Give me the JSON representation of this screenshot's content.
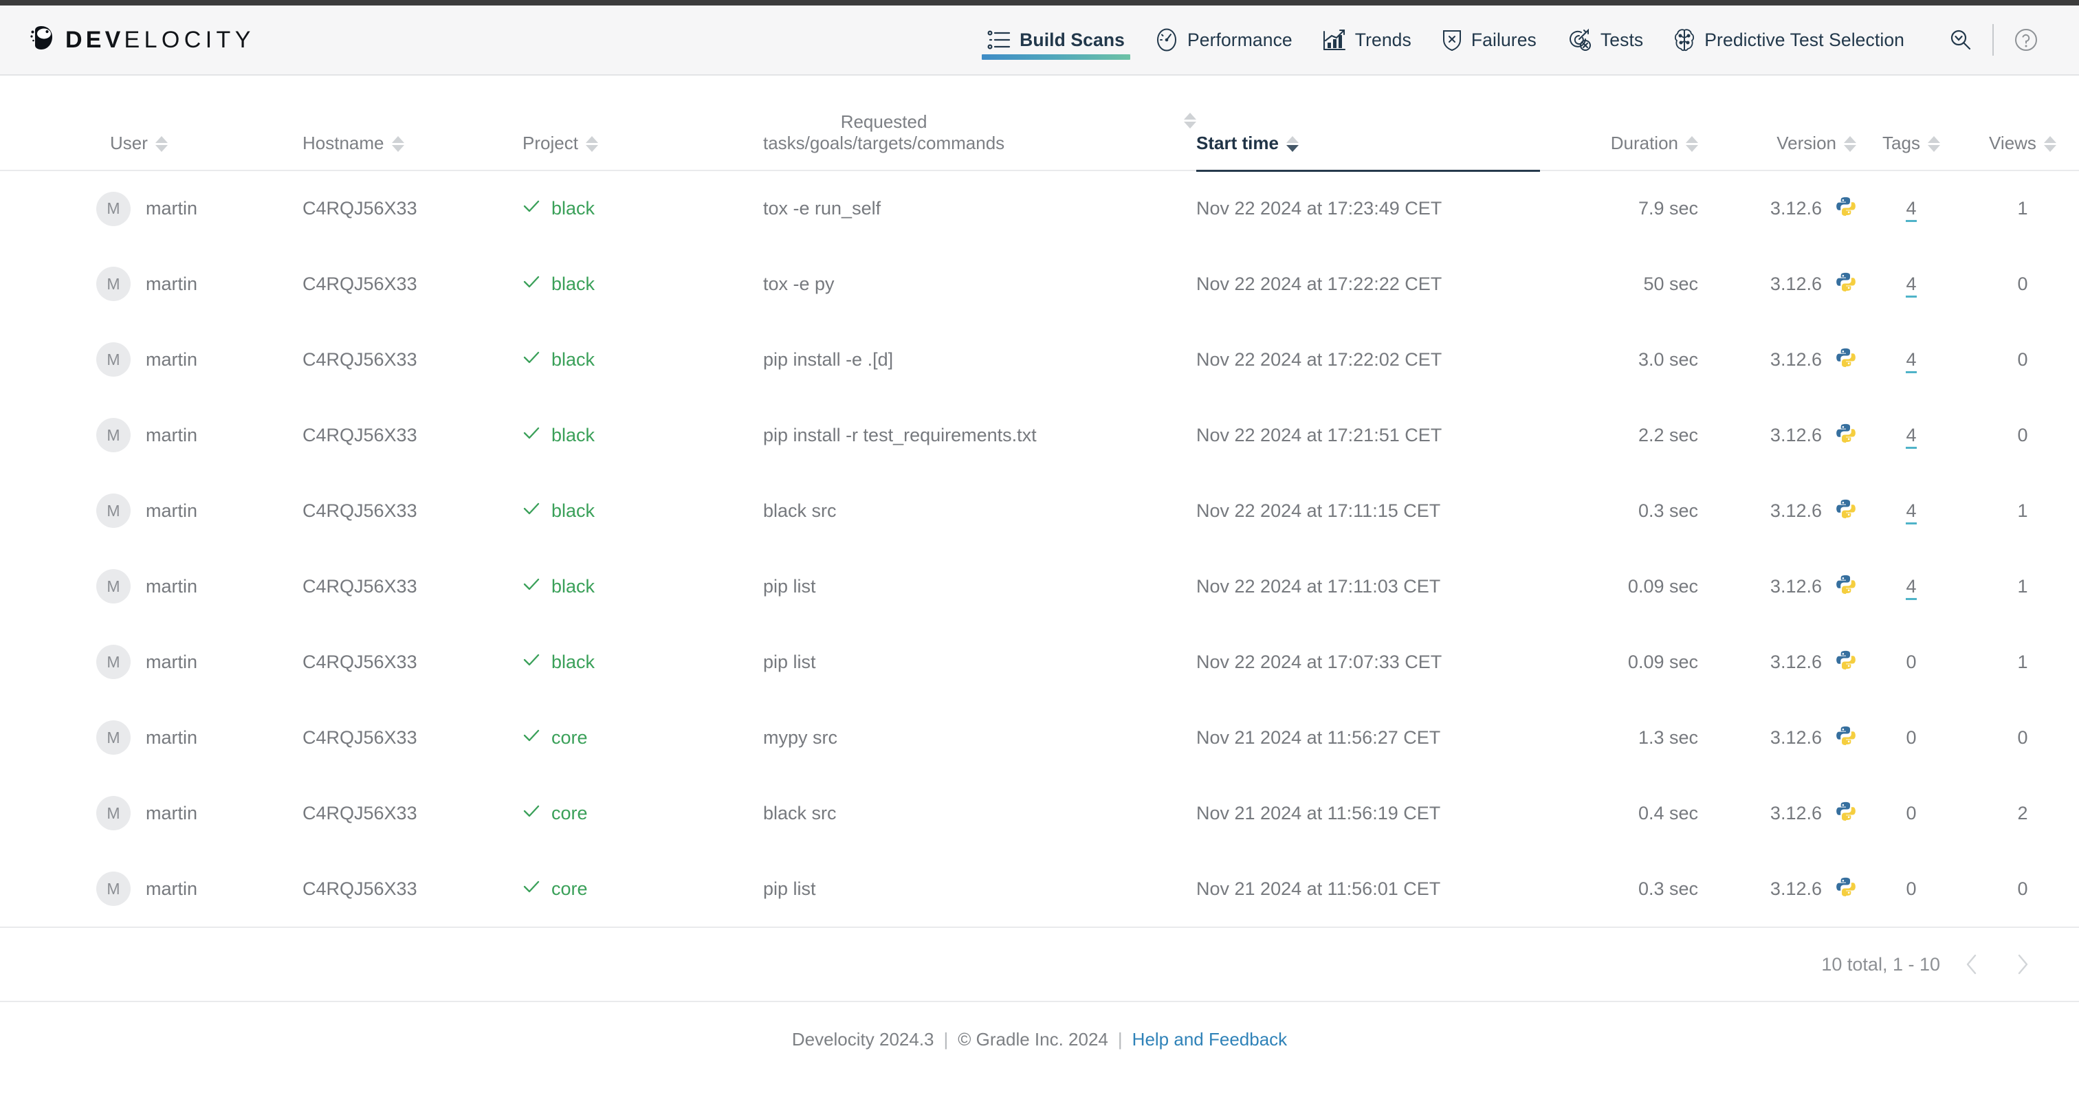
{
  "brand": {
    "logo_bold": "DEV",
    "logo_light": "ELOCITY",
    "accent_start": "#3f8cc6",
    "accent_end": "#6dc2a6",
    "active_underline": "#263a4d",
    "link_color": "#2f82b8",
    "tag_underline": "#4fb3c8",
    "success_color": "#3aa059"
  },
  "nav": {
    "items": [
      {
        "label": "Build Scans",
        "icon": "list-icon",
        "active": true
      },
      {
        "label": "Performance",
        "icon": "gauge-icon",
        "active": false
      },
      {
        "label": "Trends",
        "icon": "trend-chart-icon",
        "active": false
      },
      {
        "label": "Failures",
        "icon": "shield-x-icon",
        "active": false
      },
      {
        "label": "Tests",
        "icon": "target-x-icon",
        "active": false
      },
      {
        "label": "Predictive Test Selection",
        "icon": "brain-icon",
        "active": false
      }
    ],
    "tools": [
      {
        "name": "search-chevron-icon",
        "label": "Search"
      },
      {
        "name": "help-circle-icon",
        "label": "Help"
      }
    ]
  },
  "table": {
    "columns": [
      {
        "key": "user",
        "label": "User",
        "sortable": true,
        "active": false,
        "align": "left"
      },
      {
        "key": "hostname",
        "label": "Hostname",
        "sortable": true,
        "active": false,
        "align": "left"
      },
      {
        "key": "project",
        "label": "Project",
        "sortable": true,
        "active": false,
        "align": "left"
      },
      {
        "key": "requested",
        "label": "Requested\ntasks/goals/targets/commands",
        "sortable": true,
        "active": false,
        "align": "left"
      },
      {
        "key": "start",
        "label": "Start time",
        "sortable": true,
        "active": true,
        "align": "left",
        "sort_direction": "desc"
      },
      {
        "key": "duration",
        "label": "Duration",
        "sortable": true,
        "active": false,
        "align": "right"
      },
      {
        "key": "version",
        "label": "Version",
        "sortable": true,
        "active": false,
        "align": "right"
      },
      {
        "key": "tags",
        "label": "Tags",
        "sortable": true,
        "active": false,
        "align": "center"
      },
      {
        "key": "views",
        "label": "Views",
        "sortable": true,
        "active": false,
        "align": "center"
      }
    ],
    "rows": [
      {
        "avatar": "M",
        "user": "martin",
        "hostname": "C4RQJ56X33",
        "project": "black",
        "status": "success",
        "requested": "tox -e run_self",
        "start": "Nov 22 2024 at 17:23:49 CET",
        "duration": "7.9 sec",
        "version": "3.12.6",
        "version_icon": "python-icon",
        "tags": "4",
        "tags_link": true,
        "views": "1"
      },
      {
        "avatar": "M",
        "user": "martin",
        "hostname": "C4RQJ56X33",
        "project": "black",
        "status": "success",
        "requested": "tox -e py",
        "start": "Nov 22 2024 at 17:22:22 CET",
        "duration": "50 sec",
        "version": "3.12.6",
        "version_icon": "python-icon",
        "tags": "4",
        "tags_link": true,
        "views": "0"
      },
      {
        "avatar": "M",
        "user": "martin",
        "hostname": "C4RQJ56X33",
        "project": "black",
        "status": "success",
        "requested": "pip install -e .[d]",
        "start": "Nov 22 2024 at 17:22:02 CET",
        "duration": "3.0 sec",
        "version": "3.12.6",
        "version_icon": "python-icon",
        "tags": "4",
        "tags_link": true,
        "views": "0"
      },
      {
        "avatar": "M",
        "user": "martin",
        "hostname": "C4RQJ56X33",
        "project": "black",
        "status": "success",
        "requested": "pip install -r test_requirements.txt",
        "start": "Nov 22 2024 at 17:21:51 CET",
        "duration": "2.2 sec",
        "version": "3.12.6",
        "version_icon": "python-icon",
        "tags": "4",
        "tags_link": true,
        "views": "0"
      },
      {
        "avatar": "M",
        "user": "martin",
        "hostname": "C4RQJ56X33",
        "project": "black",
        "status": "success",
        "requested": "black src",
        "start": "Nov 22 2024 at 17:11:15 CET",
        "duration": "0.3 sec",
        "version": "3.12.6",
        "version_icon": "python-icon",
        "tags": "4",
        "tags_link": true,
        "views": "1"
      },
      {
        "avatar": "M",
        "user": "martin",
        "hostname": "C4RQJ56X33",
        "project": "black",
        "status": "success",
        "requested": "pip list",
        "start": "Nov 22 2024 at 17:11:03 CET",
        "duration": "0.09 sec",
        "version": "3.12.6",
        "version_icon": "python-icon",
        "tags": "4",
        "tags_link": true,
        "views": "1"
      },
      {
        "avatar": "M",
        "user": "martin",
        "hostname": "C4RQJ56X33",
        "project": "black",
        "status": "success",
        "requested": "pip list",
        "start": "Nov 22 2024 at 17:07:33 CET",
        "duration": "0.09 sec",
        "version": "3.12.6",
        "version_icon": "python-icon",
        "tags": "0",
        "tags_link": false,
        "views": "1"
      },
      {
        "avatar": "M",
        "user": "martin",
        "hostname": "C4RQJ56X33",
        "project": "core",
        "status": "success",
        "requested": "mypy src",
        "start": "Nov 21 2024 at 11:56:27 CET",
        "duration": "1.3 sec",
        "version": "3.12.6",
        "version_icon": "python-icon",
        "tags": "0",
        "tags_link": false,
        "views": "0"
      },
      {
        "avatar": "M",
        "user": "martin",
        "hostname": "C4RQJ56X33",
        "project": "core",
        "status": "success",
        "requested": "black src",
        "start": "Nov 21 2024 at 11:56:19 CET",
        "duration": "0.4 sec",
        "version": "3.12.6",
        "version_icon": "python-icon",
        "tags": "0",
        "tags_link": false,
        "views": "2"
      },
      {
        "avatar": "M",
        "user": "martin",
        "hostname": "C4RQJ56X33",
        "project": "core",
        "status": "success",
        "requested": "pip list",
        "start": "Nov 21 2024 at 11:56:01 CET",
        "duration": "0.3 sec",
        "version": "3.12.6",
        "version_icon": "python-icon",
        "tags": "0",
        "tags_link": false,
        "views": "0"
      }
    ]
  },
  "pagination": {
    "summary": "10 total, 1 - 10",
    "prev_icon": "chevron-left-icon",
    "next_icon": "chevron-right-icon"
  },
  "footer": {
    "product": "Develocity 2024.3",
    "copyright": "© Gradle Inc. 2024",
    "help_link": "Help and Feedback",
    "separator": "|"
  }
}
